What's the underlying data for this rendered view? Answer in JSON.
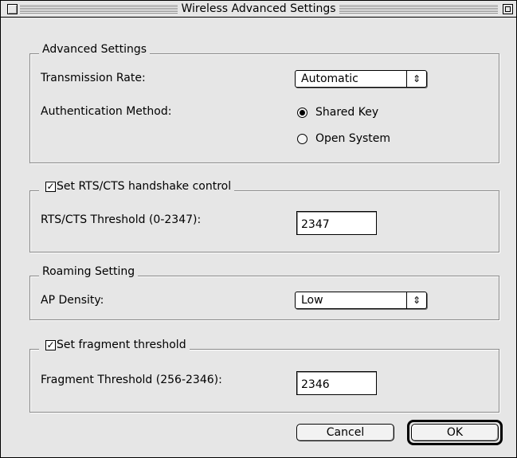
{
  "window": {
    "title": "Wireless Advanced Settings"
  },
  "advanced": {
    "group_label": "Advanced Settings",
    "transmission_rate_label": "Transmission Rate:",
    "transmission_rate_value": "Automatic",
    "auth_method_label": "Authentication Method:",
    "auth_options": [
      {
        "label": "Shared Key",
        "selected": true
      },
      {
        "label": "Open System",
        "selected": false
      }
    ]
  },
  "rts": {
    "checkbox_label": "Set RTS/CTS handshake control",
    "checked": true,
    "threshold_label": "RTS/CTS Threshold (0-2347):",
    "threshold_value": "2347"
  },
  "roaming": {
    "group_label": "Roaming Setting",
    "ap_density_label": "AP Density:",
    "ap_density_value": "Low"
  },
  "fragment": {
    "checkbox_label": "Set fragment threshold",
    "checked": true,
    "threshold_label": "Fragment Threshold (256-2346):",
    "threshold_value": "2346"
  },
  "buttons": {
    "cancel_label": "Cancel",
    "ok_label": "OK"
  },
  "icons": {
    "popup_arrows": "up-down-arrows-icon",
    "check_mark": "check-icon",
    "close_box": "close-box-icon",
    "zoom_box": "zoom-box-icon"
  }
}
